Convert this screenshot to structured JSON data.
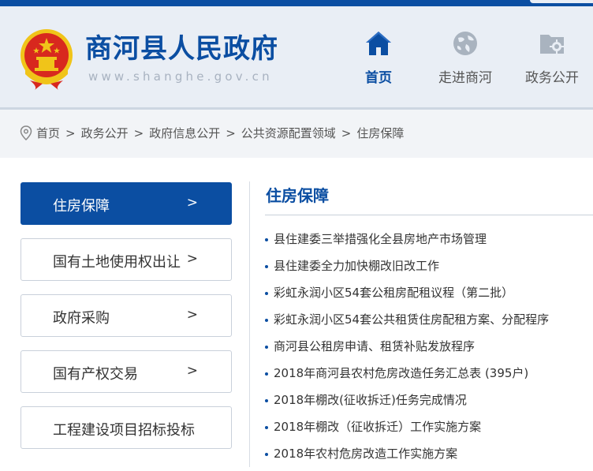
{
  "header": {
    "site_title": "商河县人民政府",
    "site_url": "www.shanghe.gov.cn",
    "nav": [
      {
        "label": "首页",
        "icon": "home-icon",
        "active": true
      },
      {
        "label": "走进商河",
        "icon": "globe-icon",
        "active": false
      },
      {
        "label": "政务公开",
        "icon": "folder-gear-icon",
        "active": false
      }
    ]
  },
  "breadcrumb": {
    "icon": "location-pin-icon",
    "items": [
      "首页",
      "政务公开",
      "政府信息公开",
      "公共资源配置领域",
      "住房保障"
    ],
    "separator": ">"
  },
  "sidebar": {
    "items": [
      {
        "label": "住房保障",
        "arrow": ">",
        "active": true
      },
      {
        "label": "国有土地使用权出让",
        "arrow": ">",
        "active": false
      },
      {
        "label": "政府采购",
        "arrow": ">",
        "active": false
      },
      {
        "label": "国有产权交易",
        "arrow": ">",
        "active": false
      },
      {
        "label": "工程建设项目招标投标",
        "arrow": "",
        "active": false
      }
    ]
  },
  "content": {
    "title": "住房保障",
    "articles": [
      "县住建委三举措强化全县房地产市场管理",
      "县住建委全力加快棚改旧改工作",
      "彩虹永润小区54套公租房配租议程（第二批）",
      "彩虹永润小区54套公共租赁住房配租方案、分配程序",
      "商河县公租房申请、租赁补贴发放程序",
      "2018年商河县农村危房改造任务汇总表 (395户)",
      "2018年棚改(征收拆迁)任务完成情况",
      "2018年棚改（征收拆迁）工作实施方案",
      "2018年农村危房改造工作实施方案"
    ]
  },
  "colors": {
    "brand_blue": "#0b4ea2",
    "header_bg": "#e9eef5",
    "emblem_red": "#d8281e",
    "emblem_gold": "#f0c419"
  }
}
